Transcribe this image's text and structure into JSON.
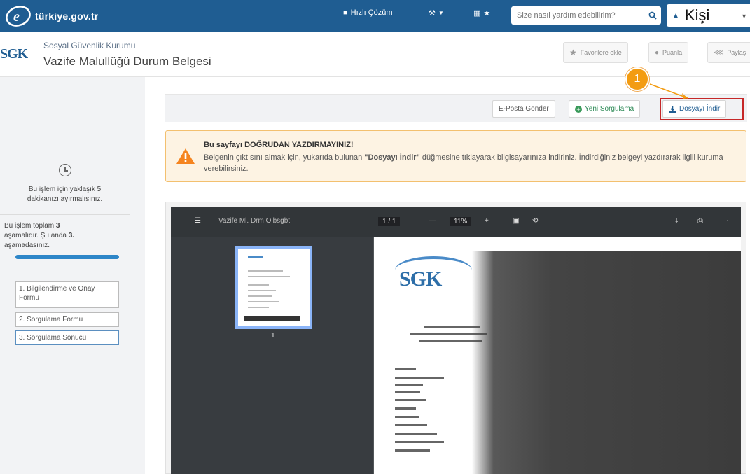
{
  "topbar": {
    "logo_text": "türkiye.gov.tr",
    "quick_solution": "Hızlı Çözüm",
    "search_placeholder": "Size nasıl yardım edebilirim?",
    "user_name": "Kişi",
    "bg_color": "#1f5d92"
  },
  "header": {
    "logo_text": "SGK",
    "institution": "Sosyal Güvenlik Kurumu",
    "page_title": "Vazife Malullüğü Durum Belgesi",
    "favorites_label": "Favorilere ekle",
    "rate_label": "Puanla",
    "share_label": "Paylaş"
  },
  "sidebar": {
    "time_note_line1": "Bu işlem için yaklaşık 5",
    "time_note_line2": "dakikanızı ayırmalısınız.",
    "steps_prefix": "Bu işlem toplam",
    "steps_total": "3",
    "steps_middle": "aşamalıdır. Şu anda",
    "steps_current": "3.",
    "steps_suffix": "aşamadasınız.",
    "progress": 1.0,
    "steps": [
      {
        "label": "1. Bilgilendirme ve Onay Formu"
      },
      {
        "label": "2. Sorgulama Formu"
      },
      {
        "label": "3. Sorgulama Sonucu"
      }
    ]
  },
  "actions": {
    "email_label": "E-Posta Gönder",
    "new_query_label": "Yeni Sorgulama",
    "download_label": "Dosyayı İndir",
    "annotation_number": "1"
  },
  "warning": {
    "title": "Bu sayfayı DOĞRUDAN YAZDIRMAYINIZ!",
    "text_before": "Belgenin çıktısını almak için, yukarıda bulunan ",
    "text_bold": "\"Dosyayı İndir\"",
    "text_after": " düğmesine tıklayarak bilgisayarınıza indiriniz. İndirdiğiniz belgeyi yazdırarak ilgili kuruma verebilirsiniz."
  },
  "viewer": {
    "file_name": "Vazife Ml. Drm Olbsgbt",
    "page_indicator": "1 / 1",
    "zoom": "11%",
    "thumb_page_number": "1",
    "page_logo": "SGK"
  }
}
